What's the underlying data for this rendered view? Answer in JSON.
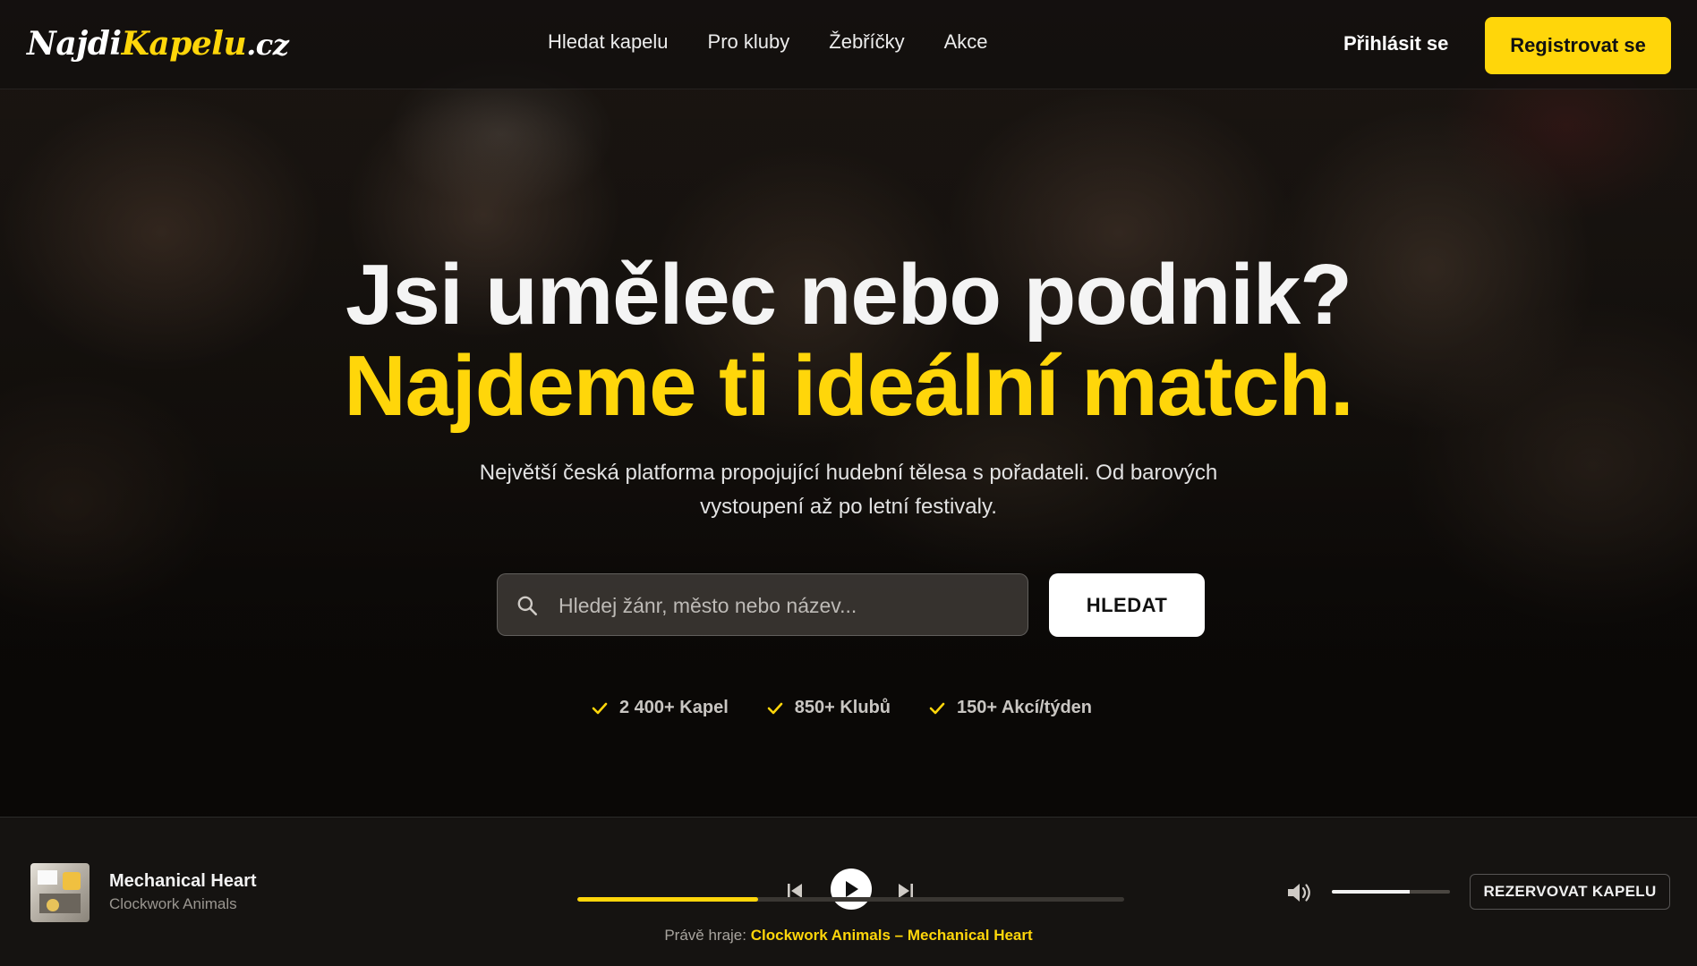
{
  "colors": {
    "accent": "#ffd60a",
    "background": "#0d0b09",
    "player_bg": "#151311"
  },
  "nav": {
    "logo": {
      "part1": "Najdi",
      "part2": "Kapelu",
      "part3": ".cz"
    },
    "links": [
      "Hledat kapelu",
      "Pro kluby",
      "Žebříčky",
      "Akce"
    ],
    "login": "Přihlásit se",
    "register": "Registrovat se"
  },
  "hero": {
    "headline1": "Jsi umělec nebo podnik?",
    "headline2": "Najdeme ti ideální match.",
    "subtitle": "Největší česká platforma propojující hudební tělesa s pořadateli. Od barových vystoupení až po letní festivaly.",
    "search": {
      "icon": "search-icon",
      "placeholder": "Hledej žánr, město nebo název...",
      "value": "",
      "button": "HLEDAT"
    },
    "stats": [
      {
        "icon": "check-icon",
        "label": "2 400+ Kapel"
      },
      {
        "icon": "check-icon",
        "label": "850+ Klubů"
      },
      {
        "icon": "check-icon",
        "label": "150+ Akcí/týden"
      }
    ]
  },
  "player": {
    "track_title": "Mechanical Heart",
    "track_artist": "Clockwork Animals",
    "progress": 0.33,
    "volume": 0.66,
    "now_playing_label": "Právě hraje:",
    "now_playing_track": "Clockwork Animals – Mechanical Heart",
    "book_button": "REZERVOVAT KAPELU"
  }
}
